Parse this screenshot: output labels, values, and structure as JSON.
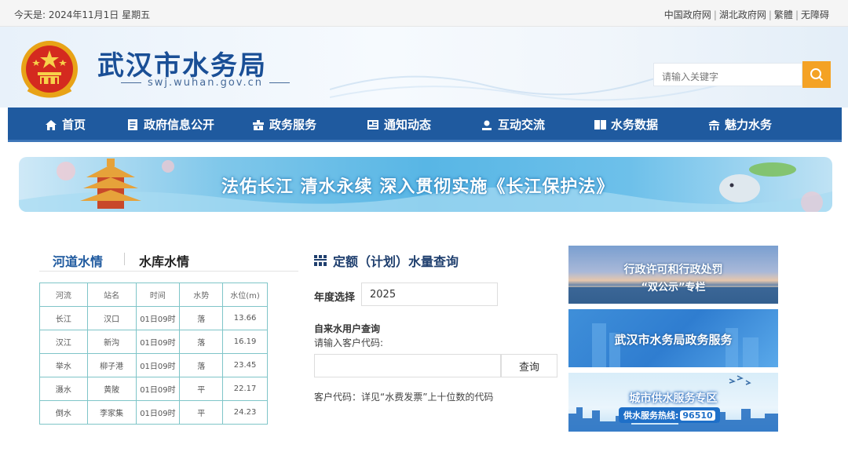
{
  "topbar": {
    "date": "今天是: 2024年11月1日 星期五",
    "links": [
      "中国政府网",
      "湖北政府网",
      "繁體",
      "无障碍"
    ]
  },
  "header": {
    "title": "武汉市水务局",
    "domain": "swj.wuhan.gov.cn",
    "search_placeholder": "请输入关键字"
  },
  "nav": {
    "items": [
      {
        "label": "首页",
        "icon": "home-icon"
      },
      {
        "label": "政府信息公开",
        "icon": "document-icon"
      },
      {
        "label": "政务服务",
        "icon": "service-icon"
      },
      {
        "label": "通知动态",
        "icon": "news-icon"
      },
      {
        "label": "互动交流",
        "icon": "user-icon"
      },
      {
        "label": "水务数据",
        "icon": "book-icon"
      },
      {
        "label": "魅力水务",
        "icon": "pavilion-icon"
      }
    ]
  },
  "banner": {
    "slogan": "法佑长江 清水永续 深入贯彻实施《长江保护法》"
  },
  "water_tabs": {
    "active": "河道水情",
    "second": "水库水情"
  },
  "water_table": {
    "headers": [
      "河流",
      "站名",
      "时间",
      "水势",
      "水位(m)"
    ],
    "rows": [
      [
        "长江",
        "汉口",
        "01日09时",
        "落",
        "13.66"
      ],
      [
        "汉江",
        "新沟",
        "01日09时",
        "落",
        "16.19"
      ],
      [
        "举水",
        "柳子港",
        "01日09时",
        "落",
        "23.45"
      ],
      [
        "滠水",
        "黄陂",
        "01日09时",
        "平",
        "22.17"
      ],
      [
        "倒水",
        "李家集",
        "01日09时",
        "平",
        "24.23"
      ]
    ]
  },
  "quota": {
    "title": "定额（计划）水量查询",
    "year_label": "年度选择",
    "year_value": "2025",
    "user_query_title": "自来水用户查询",
    "user_query_hint": "请输入客户代码:",
    "code_placeholder": "",
    "query_button": "查询",
    "code_note": "客户代码：详见“水费发票”上十位数的代码"
  },
  "side_banners": {
    "b1_line1": "行政许可和行政处罚",
    "b1_line2": "“双公示”专栏",
    "b2": "武汉市水务局政务服务",
    "b3_title": "城市供水服务专区",
    "b3_hotline_label": "供水服务热线:",
    "b3_hotline": "96510"
  },
  "colors": {
    "nav": "#1f5a9f",
    "title": "#1a4f96",
    "search_btn": "#f4a224",
    "table_border": "#7fc5c8"
  }
}
